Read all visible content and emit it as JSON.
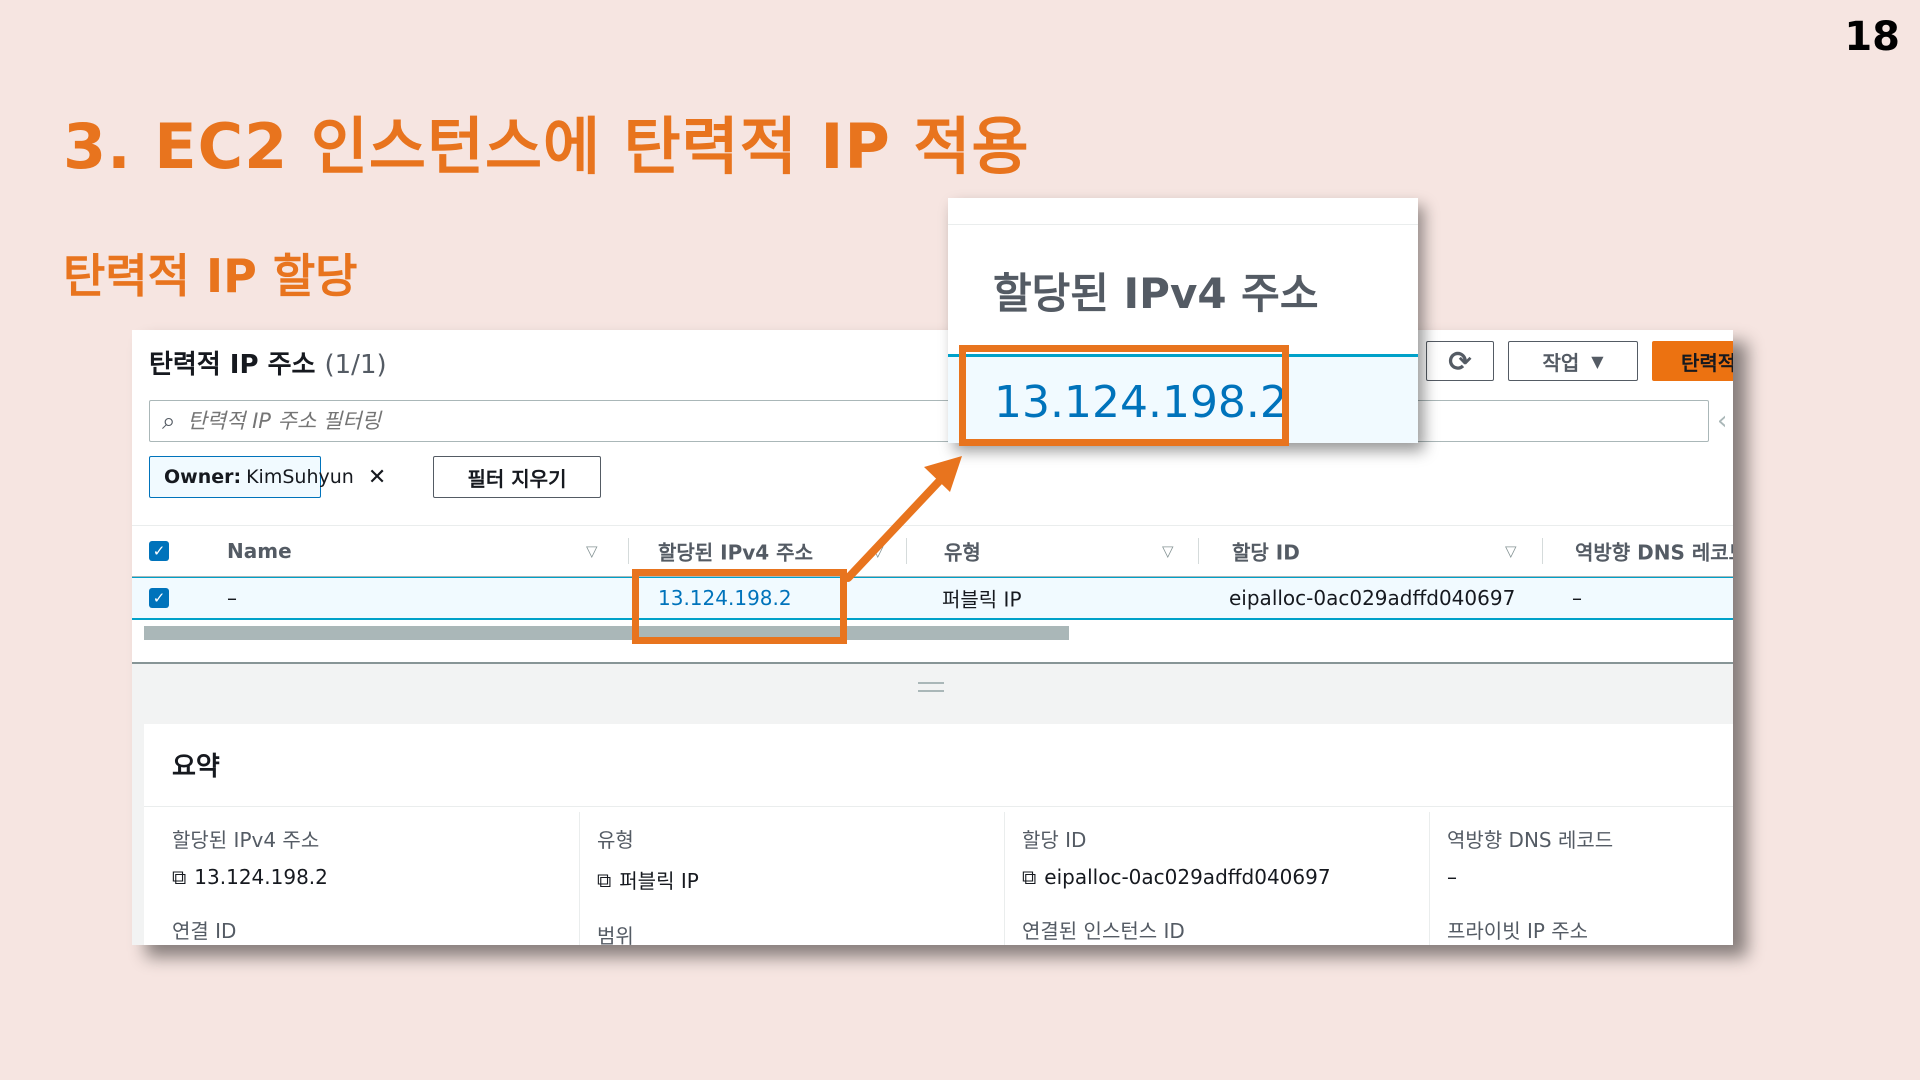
{
  "slide": {
    "page_number": "18",
    "title": "3. EC2 인스턴스에 탄력적 IP 적용",
    "subtitle": "탄력적 IP 할당"
  },
  "panel": {
    "title": "탄력적 IP 주소",
    "count": "(1/1)",
    "refresh_icon": "refresh-icon",
    "actions_label": "작업",
    "primary_label": "탄력적",
    "search_placeholder": "탄력적 IP 주소 필터링",
    "filter_token_key": "Owner:",
    "filter_token_value": "KimSuhyun",
    "clear_filters_label": "필터 지우기"
  },
  "table": {
    "columns": [
      "Name",
      "할당된 IPv4 주소",
      "유형",
      "할당 ID",
      "역방향 DNS 레코드"
    ],
    "rows": [
      {
        "name": "–",
        "ipv4": "13.124.198.2",
        "type": "퍼블릭 IP",
        "allocation_id": "eipalloc-0ac029adffd040697",
        "reverse_dns": "–"
      }
    ]
  },
  "summary": {
    "title": "요약",
    "fields": [
      {
        "label": "할당된 IPv4 주소",
        "value": "13.124.198.2",
        "next_label": "연결 ID"
      },
      {
        "label": "유형",
        "value": "퍼블릭 IP",
        "next_label": "범위"
      },
      {
        "label": "할당 ID",
        "value": "eipalloc-0ac029adffd040697",
        "next_label": "연결된 인스턴스 ID"
      },
      {
        "label": "역방향 DNS 레코드",
        "value": "–",
        "next_label": "프라이빗 IP 주소"
      }
    ]
  },
  "zoom": {
    "header": "할당된 IPv4 주소",
    "value": "13.124.198.2"
  },
  "colors": {
    "accent": "#e8741e",
    "link": "#0073bb",
    "background": "#f6e5e1"
  }
}
